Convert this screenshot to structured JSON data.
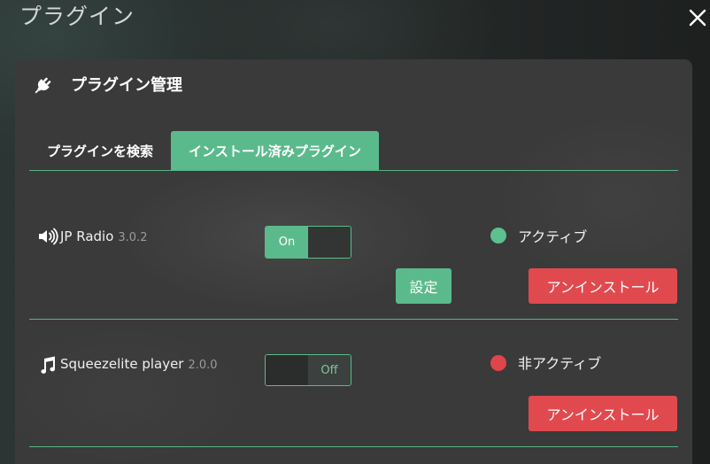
{
  "page": {
    "title": "プラグイン",
    "close_icon": "close-icon"
  },
  "panel": {
    "icon": "plug-icon",
    "title": "プラグイン管理"
  },
  "tabs": [
    {
      "label": "プラグインを検索",
      "active": false
    },
    {
      "label": "インストール済みプラグイン",
      "active": true
    }
  ],
  "plugins": [
    {
      "icon": "speaker-icon",
      "name": "JP Radio",
      "version": "3.0.2",
      "toggle_label": "On",
      "enabled": true,
      "status": "アクティブ",
      "status_color": "#5cc08f",
      "settings_label": "設定",
      "uninstall_label": "アンインストール"
    },
    {
      "icon": "music-note-icon",
      "name": "Squeezelite player",
      "version": "2.0.0",
      "toggle_label": "Off",
      "enabled": false,
      "status": "非アクティブ",
      "status_color": "#e0454b",
      "uninstall_label": "アンインストール"
    }
  ],
  "colors": {
    "accent": "#5bba8c",
    "danger": "#e04a4f"
  }
}
